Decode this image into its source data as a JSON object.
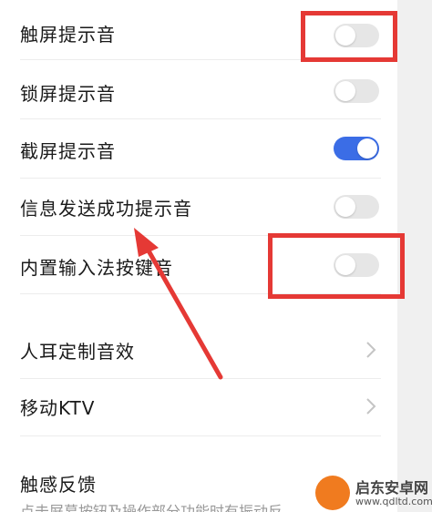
{
  "settings": {
    "toggles": [
      {
        "label": "触屏提示音",
        "on": false
      },
      {
        "label": "锁屏提示音",
        "on": false
      },
      {
        "label": "截屏提示音",
        "on": true
      },
      {
        "label": "信息发送成功提示音",
        "on": false
      },
      {
        "label": "内置输入法按键音",
        "on": false
      }
    ],
    "links": [
      {
        "label": "人耳定制音效"
      },
      {
        "label": "移动KTV"
      }
    ],
    "haptics": {
      "label": "触感反馈",
      "sub": "点击屏幕按钮及操作部分功能时有振动反"
    }
  },
  "colors": {
    "accent": "#3b6de6",
    "annotation": "#e53935"
  },
  "watermark": {
    "title": "启东安卓网",
    "url": "www.qdltd.com"
  }
}
